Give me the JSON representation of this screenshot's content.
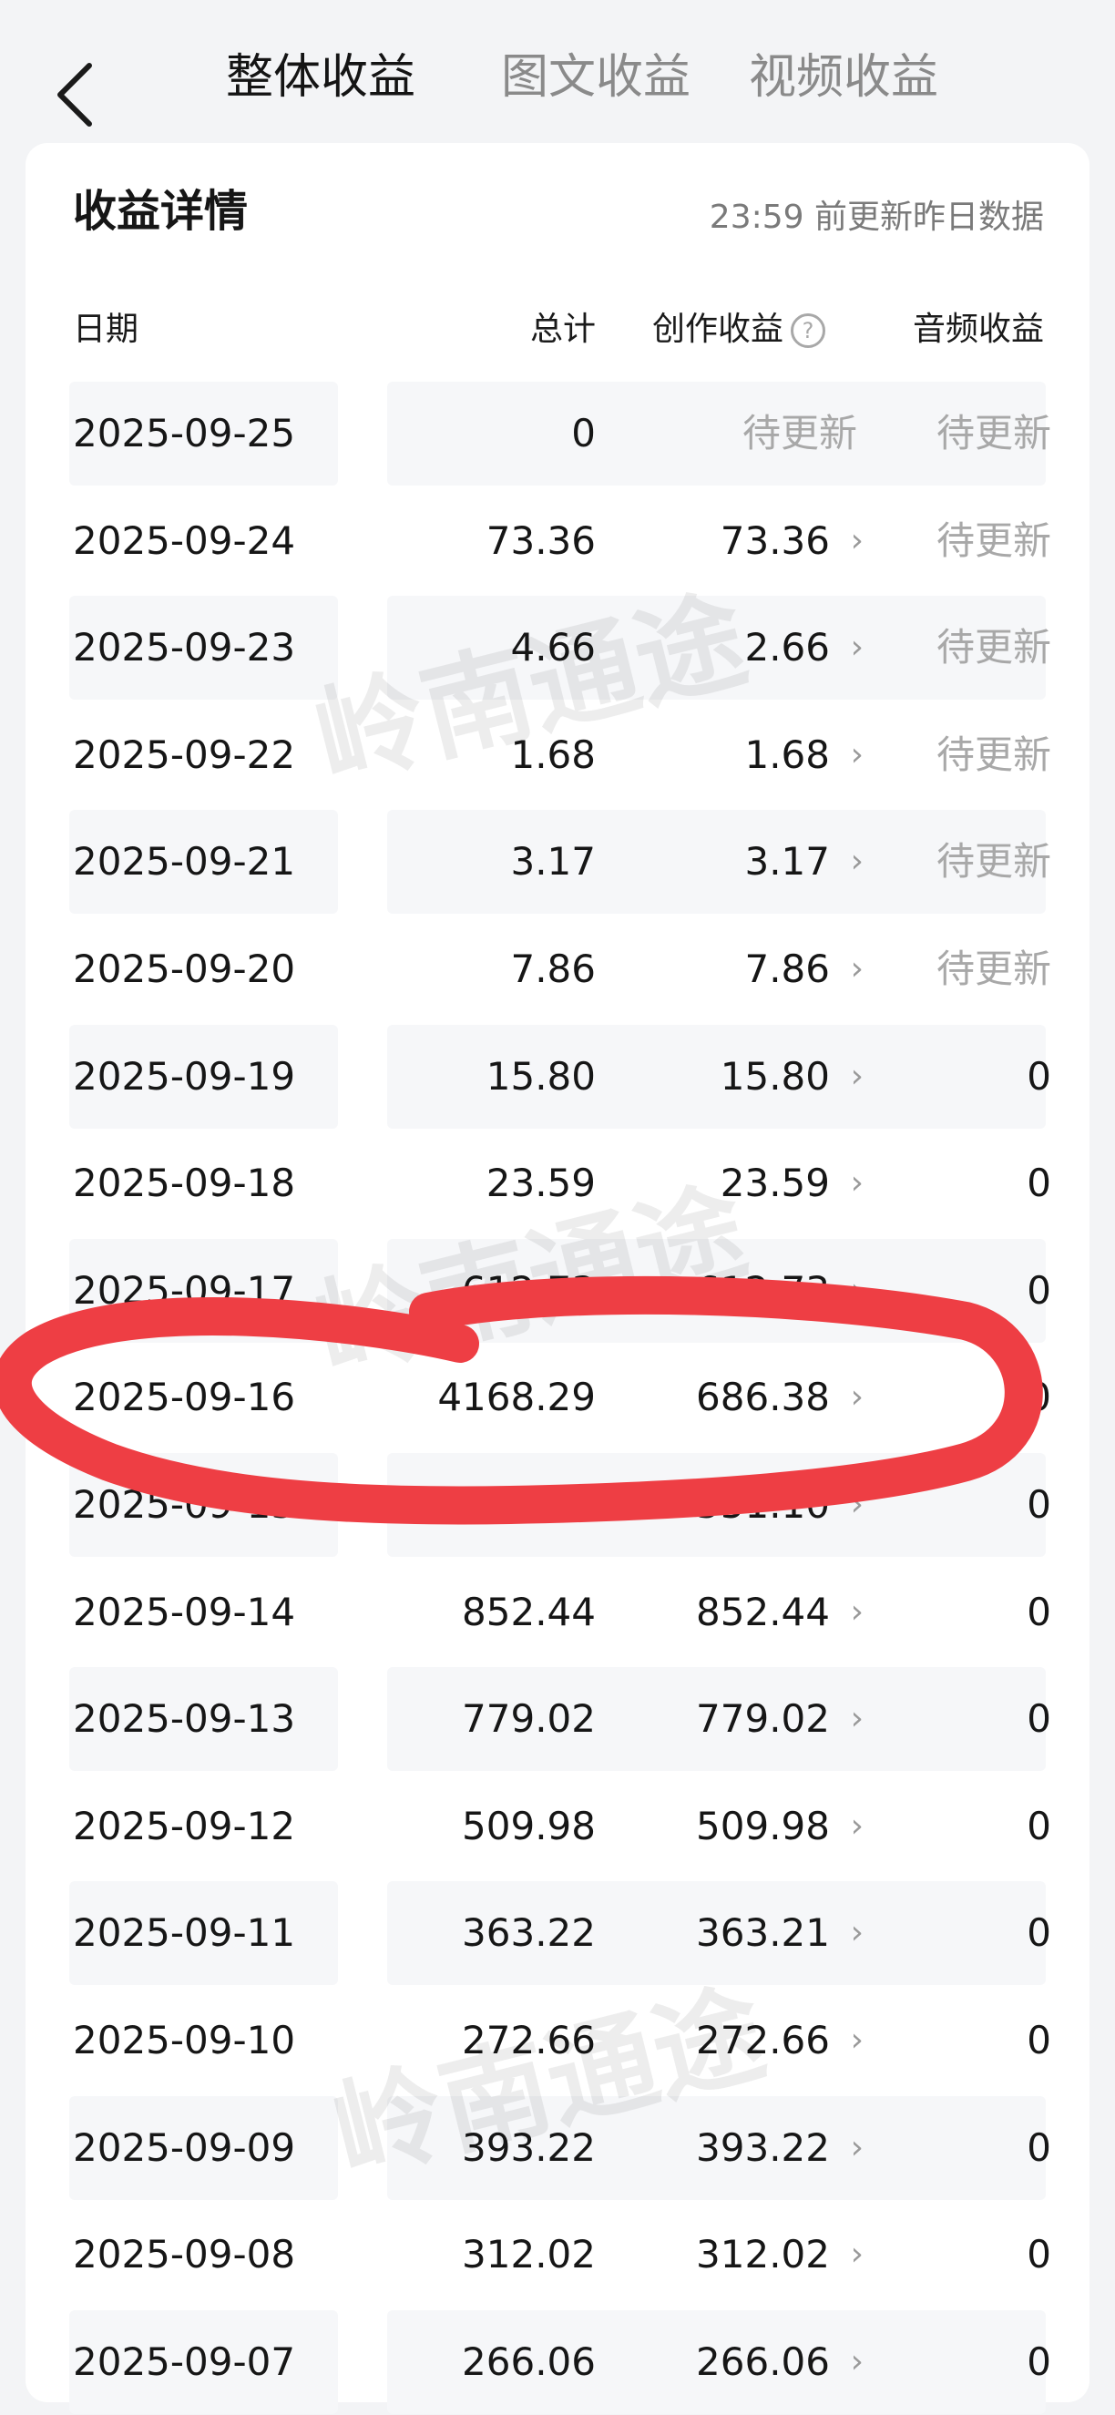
{
  "tabs": [
    {
      "label": "整体收益",
      "active": true
    },
    {
      "label": "图文收益",
      "active": false
    },
    {
      "label": "视频收益",
      "active": false
    }
  ],
  "card": {
    "title": "收益详情",
    "update_note": "23:59 前更新昨日数据"
  },
  "columns": {
    "date": "日期",
    "total": "总计",
    "creation": "创作收益",
    "audio": "音频收益"
  },
  "help_icon_glyph": "?",
  "chevron_glyph": "›",
  "rows": [
    {
      "date": "2025-09-25",
      "total": "0",
      "creation": "待更新",
      "audio": "待更新"
    },
    {
      "date": "2025-09-24",
      "total": "73.36",
      "creation": "73.36",
      "audio": "待更新"
    },
    {
      "date": "2025-09-23",
      "total": "4.66",
      "creation": "2.66",
      "audio": "待更新"
    },
    {
      "date": "2025-09-22",
      "total": "1.68",
      "creation": "1.68",
      "audio": "待更新"
    },
    {
      "date": "2025-09-21",
      "total": "3.17",
      "creation": "3.17",
      "audio": "待更新"
    },
    {
      "date": "2025-09-20",
      "total": "7.86",
      "creation": "7.86",
      "audio": "待更新"
    },
    {
      "date": "2025-09-19",
      "total": "15.80",
      "creation": "15.80",
      "audio": "0"
    },
    {
      "date": "2025-09-18",
      "total": "23.59",
      "creation": "23.59",
      "audio": "0"
    },
    {
      "date": "2025-09-17",
      "total": "612.73",
      "creation": "612.73",
      "audio": "0"
    },
    {
      "date": "2025-09-16",
      "total": "4168.29",
      "creation": "686.38",
      "audio": "0"
    },
    {
      "date": "2025-09-15",
      "total": "551.10",
      "creation": "551.10",
      "audio": "0"
    },
    {
      "date": "2025-09-14",
      "total": "852.44",
      "creation": "852.44",
      "audio": "0"
    },
    {
      "date": "2025-09-13",
      "total": "779.02",
      "creation": "779.02",
      "audio": "0"
    },
    {
      "date": "2025-09-12",
      "total": "509.98",
      "creation": "509.98",
      "audio": "0"
    },
    {
      "date": "2025-09-11",
      "total": "363.22",
      "creation": "363.21",
      "audio": "0"
    },
    {
      "date": "2025-09-10",
      "total": "272.66",
      "creation": "272.66",
      "audio": "0"
    },
    {
      "date": "2025-09-09",
      "total": "393.22",
      "creation": "393.22",
      "audio": "0"
    },
    {
      "date": "2025-09-08",
      "total": "312.02",
      "creation": "312.02",
      "audio": "0"
    },
    {
      "date": "2025-09-07",
      "total": "266.06",
      "creation": "266.06",
      "audio": "0"
    }
  ],
  "watermark": "岭南通途",
  "colors": {
    "background": "#f3f4f6",
    "card": "#ffffff",
    "pending_text": "#a8a8a8",
    "highlight_marker": "#ee3e44"
  }
}
